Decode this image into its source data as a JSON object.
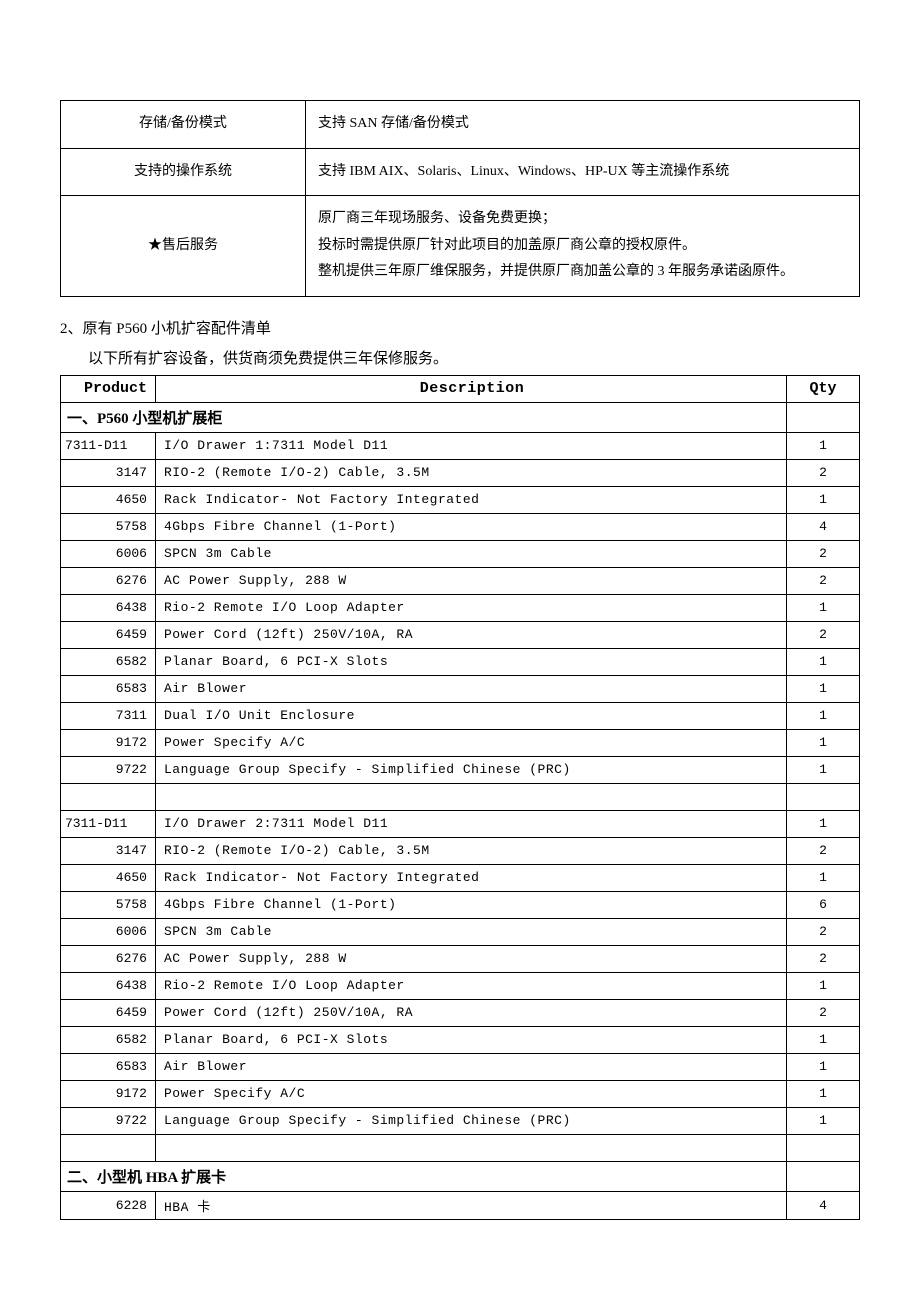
{
  "spec_table": {
    "rows": [
      {
        "label": "存储/备份模式",
        "value": "支持 SAN 存储/备份模式"
      },
      {
        "label": "支持的操作系统",
        "value": "支持 IBM AIX、Solaris、Linux、Windows、HP-UX 等主流操作系统"
      },
      {
        "label": "★售后服务",
        "value": "原厂商三年现场服务、设备免费更换；\n投标时需提供原厂针对此项目的加盖原厂商公章的授权原件。\n整机提供三年原厂维保服务，并提供原厂商加盖公章的 3 年服务承诺函原件。"
      }
    ]
  },
  "section_heading": "2、原有 P560 小机扩容配件清单",
  "section_subheading": "以下所有扩容设备，供货商须免费提供三年保修服务。",
  "parts_table": {
    "headers": {
      "product": "Product",
      "description": "Description",
      "qty": "Qty"
    },
    "groups": [
      {
        "title": "一、P560 小型机扩展柜",
        "blocks": [
          {
            "lead": {
              "product": "7311-D11",
              "description": "I/O Drawer 1:7311 Model D11",
              "qty": "1"
            },
            "items": [
              {
                "product": "3147",
                "description": "RIO-2 (Remote I/O-2) Cable, 3.5M",
                "qty": "2"
              },
              {
                "product": "4650",
                "description": "Rack Indicator- Not Factory Integrated",
                "qty": "1"
              },
              {
                "product": "5758",
                "description": "4Gbps Fibre Channel (1-Port)",
                "qty": "4"
              },
              {
                "product": "6006",
                "description": "SPCN 3m Cable",
                "qty": "2"
              },
              {
                "product": "6276",
                "description": "AC Power Supply, 288 W",
                "qty": "2"
              },
              {
                "product": "6438",
                "description": "Rio-2 Remote I/O Loop Adapter",
                "qty": "1"
              },
              {
                "product": "6459",
                "description": "Power Cord (12ft) 250V/10A, RA",
                "qty": "2"
              },
              {
                "product": "6582",
                "description": "Planar Board, 6 PCI-X Slots",
                "qty": "1"
              },
              {
                "product": "6583",
                "description": "Air Blower",
                "qty": "1"
              },
              {
                "product": "7311",
                "description": "Dual I/O Unit Enclosure",
                "qty": "1"
              },
              {
                "product": "9172",
                "description": "Power Specify A/C",
                "qty": "1"
              },
              {
                "product": "9722",
                "description": "Language Group Specify - Simplified Chinese (PRC)",
                "qty": "1"
              }
            ]
          },
          {
            "lead": {
              "product": "7311-D11",
              "description": "I/O Drawer 2:7311 Model D11",
              "qty": "1"
            },
            "items": [
              {
                "product": "3147",
                "description": "RIO-2 (Remote I/O-2) Cable, 3.5M",
                "qty": "2"
              },
              {
                "product": "4650",
                "description": "Rack Indicator- Not Factory Integrated",
                "qty": "1"
              },
              {
                "product": "5758",
                "description": "4Gbps Fibre Channel (1-Port)",
                "qty": "6"
              },
              {
                "product": "6006",
                "description": "SPCN 3m Cable",
                "qty": "2"
              },
              {
                "product": "6276",
                "description": "AC Power Supply, 288 W",
                "qty": "2"
              },
              {
                "product": "6438",
                "description": "Rio-2 Remote I/O Loop Adapter",
                "qty": "1"
              },
              {
                "product": "6459",
                "description": "Power Cord (12ft) 250V/10A, RA",
                "qty": "2"
              },
              {
                "product": "6582",
                "description": "Planar Board, 6 PCI-X Slots",
                "qty": "1"
              },
              {
                "product": "6583",
                "description": "Air Blower",
                "qty": "1"
              },
              {
                "product": "9172",
                "description": "Power Specify A/C",
                "qty": "1"
              },
              {
                "product": "9722",
                "description": "Language Group Specify - Simplified Chinese (PRC)",
                "qty": "1"
              }
            ]
          }
        ]
      },
      {
        "title": "二、小型机 HBA 扩展卡",
        "blocks": [
          {
            "lead": null,
            "items": [
              {
                "product": "6228",
                "description": "HBA 卡",
                "qty": "4"
              }
            ]
          }
        ]
      }
    ]
  }
}
